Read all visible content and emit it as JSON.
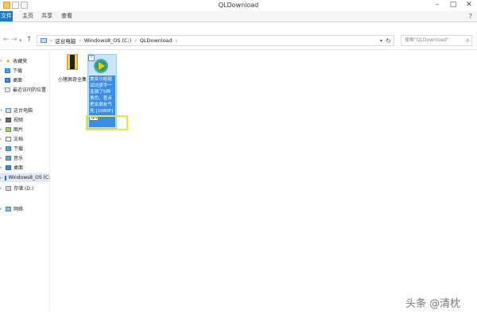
{
  "window": {
    "title": "QLDownload",
    "controls": {
      "minimize": "–",
      "maximize": "□",
      "close": "✕"
    }
  },
  "ribbon": {
    "tabs": [
      "文件",
      "主页",
      "共享",
      "查看"
    ],
    "expand_icon": "?"
  },
  "address": {
    "breadcrumbs": [
      "这台电脑",
      "Windows8_OS (C:)",
      "QLDownload"
    ],
    "separator": "›"
  },
  "search": {
    "placeholder": "搜索\"QLDownload\""
  },
  "nav": {
    "favorites": {
      "label": "收藏夹",
      "items": [
        "下载",
        "桌面",
        "最近访问的位置"
      ]
    },
    "this_pc": {
      "label": "这台电脑",
      "items": [
        "视频",
        "图片",
        "文档",
        "下载",
        "音乐",
        "桌面",
        "Windows8_OS (C:",
        "存储 (D:)"
      ]
    },
    "network": {
      "label": "网络"
    }
  },
  "files": [
    {
      "name": "小猪佩奇全集",
      "type": "folder",
      "selected": false
    },
    {
      "name_editing": "美女小姐姐试坑骄不一连骑了5种角色，差点把女朋友气死",
      "name_ext": "[1080P]",
      "name_tail": ".qlv",
      "type": "video",
      "selected": true,
      "renaming": true
    }
  ],
  "watermark": "头条 @清枕"
}
